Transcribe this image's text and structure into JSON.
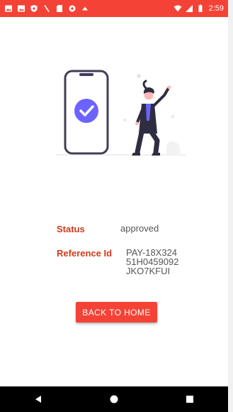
{
  "status_bar": {
    "time": "2:59",
    "color": "#f44336",
    "left_icons": [
      "image-icon",
      "image-icon",
      "shield-icon",
      "slash-icon",
      "sd-card-icon",
      "circle-icon",
      "cloud-icon"
    ],
    "right_icons": [
      "wifi-icon",
      "signal-icon",
      "battery-icon"
    ]
  },
  "payment": {
    "status_label": "Status",
    "status_value": "approved",
    "reference_label": "Reference Id",
    "reference_value": "PAY-18X324\n51H0459092\nJKO7KFUI"
  },
  "actions": {
    "back_label": "BACK TO HOME",
    "accent_color": "#f44336"
  },
  "nav_bar": {
    "items": [
      "back-icon",
      "home-icon",
      "recents-icon"
    ]
  }
}
